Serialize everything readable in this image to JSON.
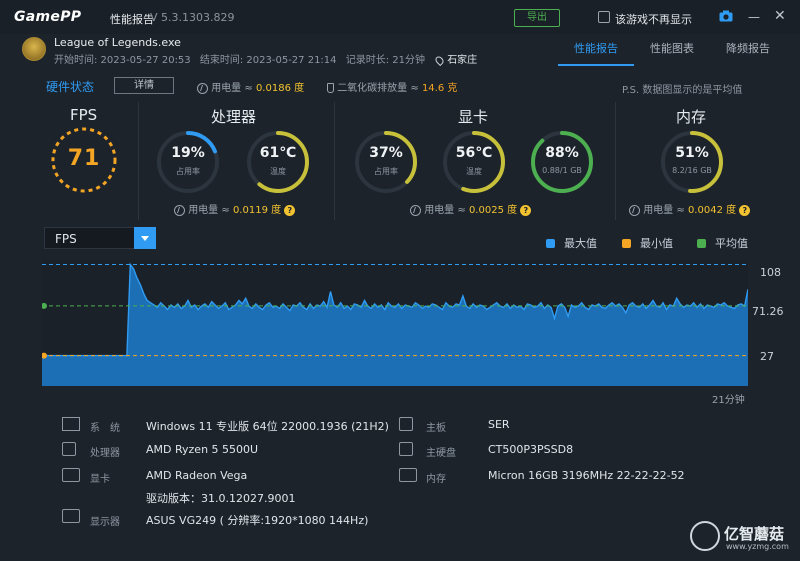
{
  "app": {
    "logo_main": "Game",
    "logo_pp": "PP",
    "window_title": "性能报告",
    "version": "V 5.3.1303.829",
    "export_label": "导出",
    "no_show_label": "该游戏不再显示"
  },
  "session": {
    "game": "League of Legends.exe",
    "start": "开始时间: 2023-05-27 20:53",
    "end": "结束时间: 2023-05-27 21:14",
    "duration": "记录时长: 21分钟",
    "city": "石家庄"
  },
  "tabs": [
    "性能报告",
    "性能图表",
    "降频报告"
  ],
  "hardware_status": {
    "title": "硬件状态",
    "detail_label": "详情",
    "power_label": "用电量 ≈",
    "power_value": "0.0186 度",
    "co2_label": "二氧化碳排放量 ≈",
    "co2_value": "14.6 克",
    "note": "P.S. 数据图显示的是平均值"
  },
  "fps": {
    "title": "FPS",
    "value": "71"
  },
  "cpu": {
    "title": "处理器",
    "usage_value": "19%",
    "usage_sub": "占用率",
    "usage_frac": 0.19,
    "temp_value": "61℃",
    "temp_sub": "温度",
    "temp_frac": 0.61,
    "power_label": "用电量 ≈",
    "power_value": "0.0119 度"
  },
  "gpu": {
    "title": "显卡",
    "usage_value": "37%",
    "usage_sub": "占用率",
    "usage_frac": 0.37,
    "temp_value": "56℃",
    "temp_sub": "温度",
    "temp_frac": 0.56,
    "vram_value": "88%",
    "vram_sub": "0.88/1 GB",
    "vram_frac": 0.88,
    "power_label": "用电量 ≈",
    "power_value": "0.0025 度"
  },
  "memory": {
    "title": "内存",
    "usage_value": "51%",
    "usage_sub": "8.2/16 GB",
    "usage_frac": 0.51,
    "power_label": "用电量 ≈",
    "power_value": "0.0042 度"
  },
  "chart_controls": {
    "metric": "FPS",
    "legend": [
      {
        "label": "最大值",
        "color": "#2f9bf2"
      },
      {
        "label": "最小值",
        "color": "#f5a524"
      },
      {
        "label": "平均值",
        "color": "#4caf50"
      }
    ],
    "y_max_label": "108",
    "y_avg_label": "71.26",
    "y_min_label": "27",
    "x_end_label": "21分钟"
  },
  "chart_data": {
    "type": "area",
    "series": [
      {
        "values": [
          27,
          27,
          27,
          27,
          27,
          27,
          27,
          27,
          27,
          27,
          27,
          27,
          27,
          27,
          27,
          27,
          27,
          27,
          27,
          27,
          27,
          27,
          27,
          27,
          27,
          27,
          108,
          104,
          96,
          90,
          82,
          76,
          74,
          72,
          70,
          74,
          71,
          68,
          72,
          70,
          73,
          69,
          71,
          76,
          70,
          72,
          68,
          71,
          73,
          70,
          75,
          72,
          69,
          71,
          74,
          68,
          70,
          72,
          76,
          73,
          78,
          71,
          69,
          73,
          70,
          68,
          72,
          74,
          70,
          71,
          69,
          73,
          70,
          67,
          72,
          71,
          74,
          70,
          68,
          73,
          69,
          72,
          71,
          75,
          70,
          84,
          72,
          70,
          74,
          69,
          71,
          68,
          73,
          72,
          70,
          76,
          71,
          69,
          73,
          70,
          72,
          68,
          74,
          71,
          70,
          73,
          69,
          72,
          71,
          70,
          74,
          72,
          69,
          71,
          70,
          73,
          72,
          70,
          68,
          74,
          71,
          70,
          73,
          72,
          80,
          71,
          69,
          73,
          70,
          72,
          71,
          68,
          70,
          72,
          74,
          71,
          70,
          73,
          69,
          72,
          70,
          71,
          68,
          73,
          72,
          70,
          71,
          74,
          69,
          72,
          70,
          60,
          71,
          73,
          70,
          62,
          72,
          70,
          71,
          74,
          70,
          68,
          72,
          71,
          73,
          70,
          69,
          72,
          74,
          71,
          73,
          70,
          65,
          72,
          74,
          71,
          70,
          73,
          69,
          72,
          76,
          71,
          70,
          74,
          68,
          72,
          71,
          78,
          73,
          70,
          72,
          71,
          74,
          70,
          73,
          69,
          72,
          71,
          70,
          73,
          72,
          74,
          71,
          70,
          69,
          72,
          73,
          71,
          86
        ]
      }
    ],
    "ylim": [
      0,
      112
    ],
    "reference_lines": {
      "max": 108,
      "avg": 71.26,
      "min": 27
    }
  },
  "system": {
    "os_label": "系　统",
    "os_value": "Windows 11 专业版 64位 22000.1936 (21H2)",
    "cpu_label": "处理器",
    "cpu_value": "AMD Ryzen 5 5500U",
    "gpu_label": "显卡",
    "gpu_value": "AMD Radeon Vega",
    "driver_value": "驱动版本：31.0.12027.9001",
    "display_label": "显示器",
    "display_value": "ASUS VG249 ( 分辨率:1920*1080 144Hz)",
    "board_label": "主板",
    "board_value": "SER",
    "disk_label": "主硬盘",
    "disk_value": "CT500P3PSSD8",
    "ram_label": "内存",
    "ram_value": "Micron 16GB 3196MHz 22-22-22-52"
  },
  "watermark": {
    "name": "亿智蘑菇",
    "url": "www.yzmg.com"
  }
}
